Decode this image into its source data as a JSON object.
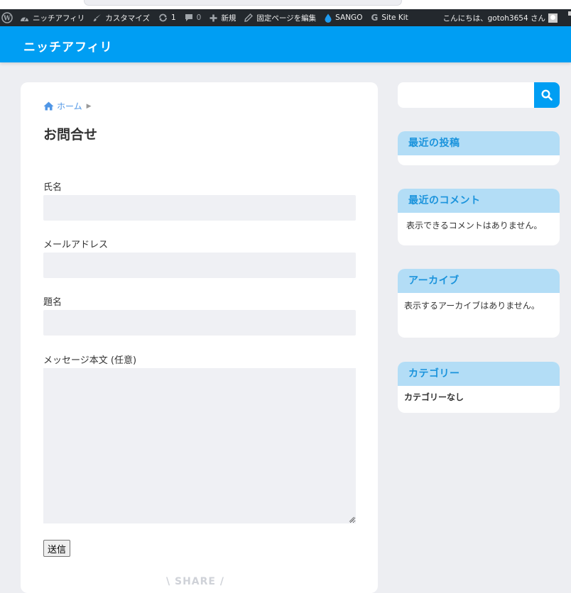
{
  "admin_bar": {
    "items": [
      {
        "icon": "wordpress-logo-icon",
        "label": ""
      },
      {
        "icon": "dashboard-icon",
        "label": "ニッチアフィリ"
      },
      {
        "icon": "brush-icon",
        "label": "カスタマイズ"
      },
      {
        "icon": "update-icon",
        "label": "1"
      },
      {
        "icon": "comment-icon",
        "label": "0"
      },
      {
        "icon": "plus-icon",
        "label": "新規"
      },
      {
        "icon": "pencil-icon",
        "label": "固定ページを編集"
      },
      {
        "icon": "drop-icon",
        "label": "SANGO"
      },
      {
        "icon": "google-g-icon",
        "label": "Site Kit"
      }
    ],
    "greeting": "こんにちは、gotoh3654 さん"
  },
  "site": {
    "title": "ニッチアフィリ"
  },
  "breadcrumb": {
    "home": "ホーム"
  },
  "page": {
    "title": "お問合せ"
  },
  "form": {
    "name_label": "氏名",
    "email_label": "メールアドレス",
    "subject_label": "題名",
    "message_label": "メッセージ本文 (任意)",
    "submit_label": "送信",
    "name_value": "",
    "email_value": "",
    "subject_value": "",
    "message_value": ""
  },
  "share": {
    "label": "\\ SHARE /"
  },
  "sidebar": {
    "search_value": "",
    "widgets": [
      {
        "title": "最近の投稿",
        "body": ""
      },
      {
        "title": "最近のコメント",
        "body": "表示できるコメントはありません。"
      },
      {
        "title": "アーカイブ",
        "body": "表示するアーカイブはありません。"
      },
      {
        "title": "カテゴリー",
        "body": "カテゴリーなし"
      }
    ]
  },
  "colors": {
    "accent": "#009ef3",
    "widget_head_bg": "#b3ddf6",
    "widget_head_text": "#1a93dc",
    "admin_bar_bg": "#23282d"
  }
}
